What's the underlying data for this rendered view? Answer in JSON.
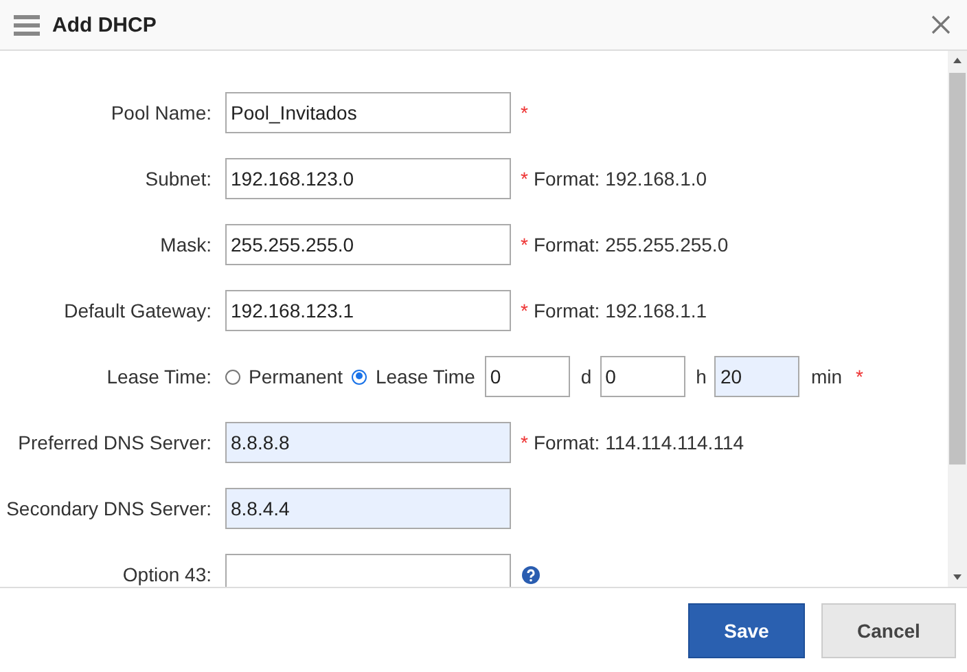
{
  "dialog": {
    "title": "Add DHCP"
  },
  "fields": [
    {
      "kind": "input",
      "label": "Pool Name:",
      "value": "Pool_Invitados",
      "highlighted": false,
      "mark": "*"
    },
    {
      "kind": "input",
      "label": "Subnet:",
      "value": "192.168.123.0",
      "highlighted": false,
      "mark": "*",
      "note": "Format: 192.168.1.0"
    },
    {
      "kind": "input",
      "label": "Mask:",
      "value": "255.255.255.0",
      "highlighted": false,
      "mark": "*",
      "note": "Format: 255.255.255.0"
    },
    {
      "kind": "input",
      "label": "Default Gateway:",
      "value": "192.168.123.1",
      "highlighted": false,
      "mark": "*",
      "note": "Format: 192.168.1.1"
    },
    {
      "kind": "lease",
      "label": "Lease Time:",
      "mark": "*",
      "options": [
        {
          "label": "Permanent",
          "selected": false
        },
        {
          "label": "Lease Time",
          "selected": true
        }
      ],
      "parts": [
        {
          "value": "0",
          "unit": "d",
          "highlighted": false
        },
        {
          "value": "0",
          "unit": "h",
          "highlighted": false
        },
        {
          "value": "20",
          "unit": "min",
          "highlighted": true
        }
      ]
    },
    {
      "kind": "input",
      "label": "Preferred DNS Server:",
      "value": "8.8.8.8",
      "highlighted": true,
      "mark": "*",
      "note": "Format: 114.114.114.114"
    },
    {
      "kind": "input",
      "label": "Secondary DNS Server:",
      "value": "8.8.4.4",
      "highlighted": true
    },
    {
      "kind": "input",
      "label": "Option 43:",
      "highlighted": false,
      "help": true
    }
  ],
  "buttons": [
    {
      "label": "Save",
      "kind": "primary"
    },
    {
      "label": "Cancel",
      "kind": "secondary"
    }
  ]
}
